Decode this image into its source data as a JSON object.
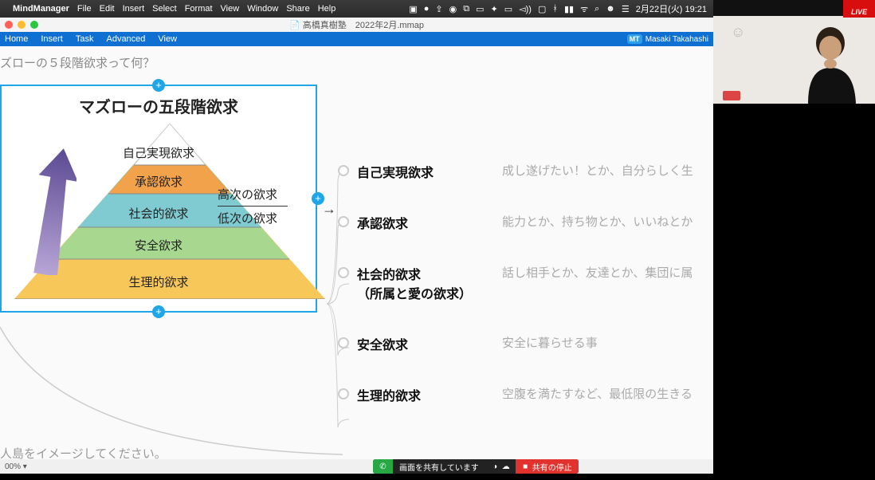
{
  "mac_menu": {
    "app": "MindManager",
    "items": [
      "File",
      "Edit",
      "Insert",
      "Select",
      "Format",
      "View",
      "Window",
      "Share",
      "Help"
    ],
    "date": "2月22日(火)  19:21",
    "status_icons": [
      "video-icon",
      "chat-icon",
      "dropbox-icon",
      "record-icon",
      "display-icon",
      "screen-icon",
      "flame-icon",
      "monitor-icon",
      "sound-icon",
      "tv-icon",
      "bluetooth-icon",
      "battery-icon",
      "wifi-icon",
      "search-icon",
      "user-icon",
      "control-icon"
    ]
  },
  "window": {
    "title_icon": "📄",
    "title": "高橋真樹塾　2022年2月.mmap"
  },
  "ribbon": {
    "tabs": [
      "Home",
      "Insert",
      "Task",
      "Advanced",
      "View"
    ],
    "user_badge": "MT",
    "user": "Masaki Takahashi"
  },
  "canvas": {
    "heading": "ズローの５段階欲求って何？",
    "selected_node": {
      "title": "マズローの五段階欲求",
      "levels": [
        "自己実現欲求",
        "承認欲求",
        "社会的欲求",
        "安全欲求",
        "生理的欲求"
      ],
      "side": {
        "high": "高次の欲求",
        "low": "低次の欲求"
      }
    },
    "connector_arrow": "→",
    "children": [
      {
        "title": "自己実現欲求",
        "desc": "成し遂げたい！とか、自分らしく生"
      },
      {
        "title": "承認欲求",
        "desc": "能力とか、持ち物とか、いいねとか"
      },
      {
        "title": "社会的欲求\n（所属と愛の欲求）",
        "desc": "話し相手とか、友達とか、集団に属"
      },
      {
        "title": "安全欲求",
        "desc": "安全に暮らせる事"
      },
      {
        "title": "生理的欲求",
        "desc": "空腹を満たすなど、最低限の生きる"
      }
    ],
    "note": "人島をイメージしてください。"
  },
  "footer": {
    "zoom": "00% ▾"
  },
  "share_bar": {
    "sharing": "画面を共有しています",
    "stop": "共有の停止"
  },
  "live_badge": "LIVE"
}
